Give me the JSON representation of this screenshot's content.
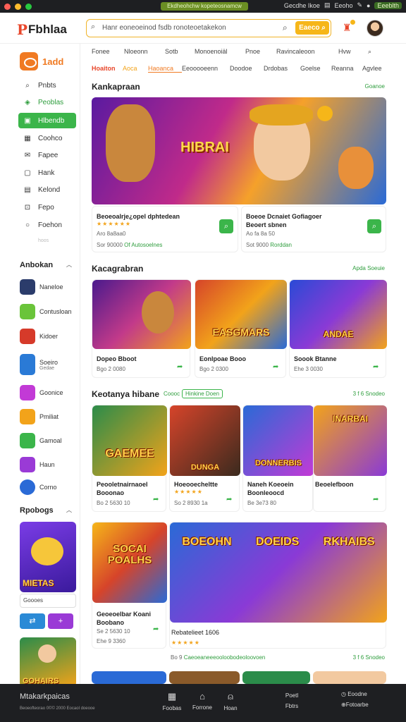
{
  "titlebar": {
    "pill": "Ekdheohchw kopeteosnamcw",
    "right_text": "Gecdhe Ikoe",
    "right_text2": "Eeoho",
    "right_green": "Eeeblth"
  },
  "header": {
    "logo": "Fbhlaa",
    "logo_mark": "P",
    "search_placeholder": "Hanr eoneoeinod fsdb ronoteoetakekon",
    "search_button": "Eaeco",
    "accent": "#f6b619"
  },
  "sidebar": {
    "app_name": "1add",
    "nav": [
      {
        "label": "Pnbts",
        "icon": "search-icon"
      },
      {
        "label": "Peoblas",
        "icon": "tag-icon"
      },
      {
        "label": "Hlbendb",
        "icon": "store-icon",
        "active": true
      },
      {
        "label": "Coohco",
        "icon": "grid-icon"
      },
      {
        "label": "Fapee",
        "icon": "gift-icon"
      },
      {
        "label": "Hank",
        "icon": "chat-icon"
      },
      {
        "label": "Kelond",
        "icon": "calendar-icon"
      },
      {
        "label": "Fepo",
        "icon": "cart-icon"
      },
      {
        "label": "Foehon",
        "icon": "clock-icon"
      }
    ],
    "more": "hoos",
    "section1": "Anbokan",
    "apps": [
      {
        "label": "Naneloe",
        "color": "#2b3c6b"
      },
      {
        "label": "Contusloan",
        "color": "#6ac43a"
      },
      {
        "label": "Kidoer",
        "color": "#d63a2a"
      },
      {
        "label": "Soeiro",
        "sub": "Gedae",
        "color": "#2a7ad6"
      },
      {
        "label": "Goonice",
        "color": "#c23ad6"
      },
      {
        "label": "Pmiliat",
        "color": "#f2a31a"
      },
      {
        "label": "Gamoal",
        "color": "#3bb54a"
      },
      {
        "label": "Haun",
        "color": "#9a3ad6"
      },
      {
        "label": "Corno",
        "color": "#2a6ad6"
      }
    ],
    "section2": "Rpobogs",
    "card_title": "MIETAS",
    "card_label": "Goooes",
    "card2_title": "GOHAIRS"
  },
  "main": {
    "tabs1": [
      "Fonee",
      "Nloeonn",
      "Sotb",
      "Monoenoiäl",
      "Pnoe",
      "Ravincaleoon",
      "Hvw"
    ],
    "tabs2": [
      "Hoaiton",
      "Aoca",
      "Haoanca",
      "Eeooooeenn",
      "Doodoe",
      "Drdobas",
      "Goelse",
      "Reanna",
      "Agvlee"
    ],
    "sec1_title": "Kankapraan",
    "sec1_link": "Goanoe",
    "hero_title": "HIBRAI",
    "featured": [
      {
        "title": "Beoeoalrje¿opel dphtedean",
        "rating": "★★★★★★",
        "sub": "Aro 8a8aa0",
        "meta": "Sor 90000",
        "meta_green": "Of Autosoelnes"
      },
      {
        "title": "Boeoe Dcnaiet Gofiagoer",
        "title2": "Beoert sbnen",
        "sub": "Ao fa 8a 50",
        "meta": "Sot 9000",
        "meta_green": "Rorddan"
      }
    ],
    "sec2_title": "Kacagrabran",
    "sec2_link": "Apda Soeuie",
    "row2": [
      {
        "title": "Dopeo Bboot",
        "meta": "Bgo 2 0080",
        "thumb": ""
      },
      {
        "title": "Eonlpoae Booo",
        "meta": "Bgo 2 0300",
        "thumb": "EASGMARS"
      },
      {
        "title": "Soook Btanne",
        "meta": "Ehe 3 0030",
        "thumb": "ANDAE"
      }
    ],
    "sec3_title": "Keotanya hibane",
    "sec3_tag1": "Coooc",
    "sec3_tag2": "Hinkine Doen",
    "sec3_link": "3 f 6 Snodeo",
    "row3": [
      {
        "title": "Peooletnairnaoel",
        "title2": "Booonao",
        "meta": "Bo 2 5630 10",
        "thumb": "GAEMEE"
      },
      {
        "title": "Hoeooecheltte",
        "rating": "★★★★★",
        "meta": "So 2 8930 1a",
        "thumb": "DUNGA"
      },
      {
        "title": "Naneh Koeoein",
        "title2": "Boonleoocd",
        "meta": "Be 3e73 80",
        "thumb": "DONNERBIS"
      },
      {
        "title": "Beoelefboon",
        "meta": "",
        "thumb": "INARBAI"
      }
    ],
    "row4": [
      {
        "title": "Geoeoelbar Koani",
        "title2": "Boobano",
        "meta": "Se 2 5630 10",
        "meta2": "Ehe 9 3360",
        "thumb": "SOCAI POALHS"
      },
      {
        "title": "Rebatelieet 1606",
        "rating": "★★★★★",
        "meta": "Bo 9",
        "meta_green": "Caeoeaneeeooloobodeoloovoen",
        "link": "3 f 6 Snodeo",
        "thumb": "BOEOHN DOEIDS RKHAIBS"
      }
    ]
  },
  "bottombar": {
    "title": "Mtakarkpaicas",
    "subtitle": "Beoeofteorao 0©© 2000 Eocaol doeooe",
    "items": [
      "Foobas",
      "Forrone",
      "Hoan"
    ],
    "right1": "Poetl",
    "right1b": "Fbtrs",
    "right2": "Eoodne",
    "right2b": "Fotoarbe"
  }
}
